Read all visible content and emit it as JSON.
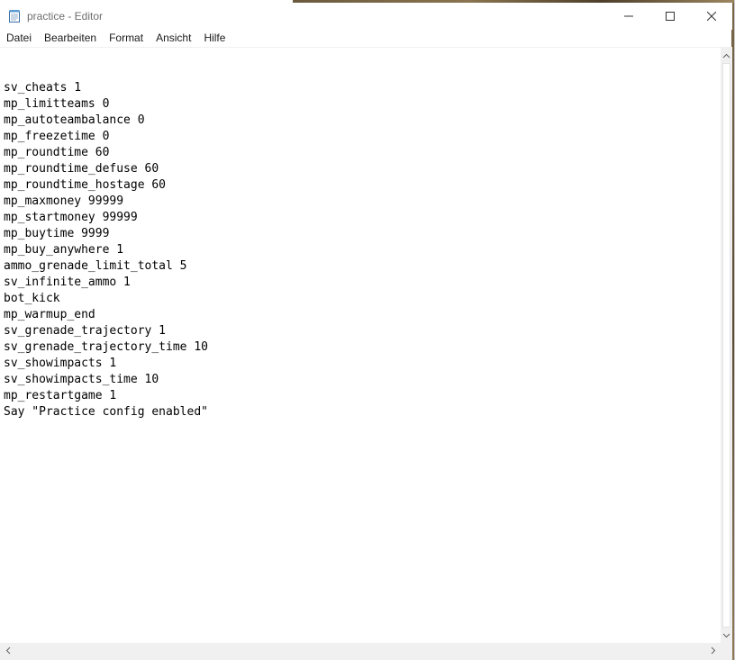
{
  "window": {
    "title": "practice - Editor",
    "app_icon": "notepad-icon"
  },
  "caption": {
    "minimize_icon": "minimize-icon",
    "maximize_icon": "maximize-icon",
    "close_icon": "close-icon"
  },
  "menu": {
    "items": [
      {
        "label": "Datei"
      },
      {
        "label": "Bearbeiten"
      },
      {
        "label": "Format"
      },
      {
        "label": "Ansicht"
      },
      {
        "label": "Hilfe"
      }
    ]
  },
  "editor": {
    "lines": [
      "",
      "sv_cheats 1",
      "mp_limitteams 0",
      "mp_autoteambalance 0",
      "mp_freezetime 0",
      "mp_roundtime 60",
      "mp_roundtime_defuse 60",
      "mp_roundtime_hostage 60",
      "mp_maxmoney 99999",
      "mp_startmoney 99999",
      "mp_buytime 9999",
      "mp_buy_anywhere 1",
      "ammo_grenade_limit_total 5",
      "sv_infinite_ammo 1",
      "bot_kick",
      "mp_warmup_end",
      "sv_grenade_trajectory 1",
      "sv_grenade_trajectory_time 10",
      "sv_showimpacts 1",
      "sv_showimpacts_time 10",
      "mp_restartgame 1",
      "Say \"Practice config enabled\""
    ]
  },
  "scrollbars": {
    "up_icon": "scroll-up-arrow-icon",
    "down_icon": "scroll-down-arrow-icon",
    "left_icon": "scroll-left-arrow-icon",
    "right_icon": "scroll-right-arrow-icon"
  }
}
